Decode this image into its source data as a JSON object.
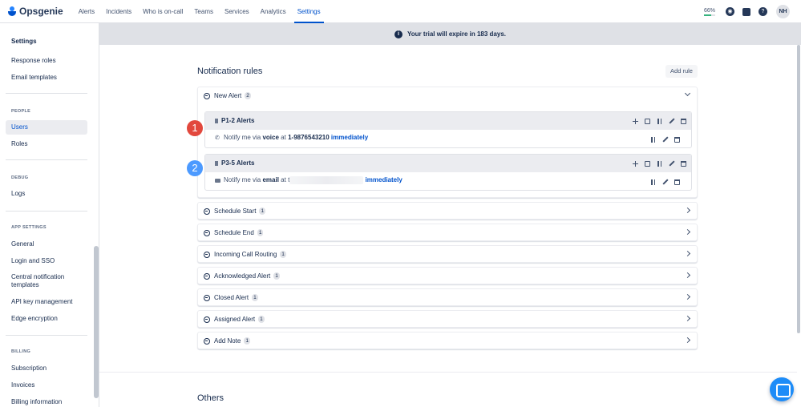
{
  "nav": {
    "brand": "Opsgenie",
    "items": [
      "Alerts",
      "Incidents",
      "Who is on-call",
      "Teams",
      "Services",
      "Analytics",
      "Settings"
    ],
    "active": "Settings",
    "progress_text": "66%",
    "progress_value": 0.66,
    "avatar_initials": "NH"
  },
  "sidebar": {
    "title": "Settings",
    "group_top": [
      "Response roles",
      "Email templates"
    ],
    "people_header": "PEOPLE",
    "people": [
      "Users",
      "Roles"
    ],
    "debug_header": "DEBUG",
    "debug": [
      "Logs"
    ],
    "app_header": "APP SETTINGS",
    "app": [
      "General",
      "Login and SSO",
      "Central notification templates",
      "API key management",
      "Edge encryption"
    ],
    "billing_header": "BILLING",
    "billing": [
      "Subscription",
      "Invoices",
      "Billing information"
    ],
    "active": "Users"
  },
  "banner": {
    "icon": "info-icon",
    "text": "Your trial will expire in 183 days."
  },
  "main": {
    "title": "Notification rules",
    "add_rule": "Add rule",
    "expanded_rule": {
      "label": "New Alert",
      "count": "2",
      "subrules": [
        {
          "step": "1",
          "title": "P1-2 Alerts",
          "prefix": "Notify me via",
          "method": "voice",
          "at": "at",
          "target": "1-9876543210",
          "when": "immediately"
        },
        {
          "step": "2",
          "title": "P3-5 Alerts",
          "prefix": "Notify me via",
          "method": "email",
          "at": "at",
          "target_start": "t",
          "when": "immediately"
        }
      ]
    },
    "rules": [
      {
        "label": "Schedule Start",
        "count": "1"
      },
      {
        "label": "Schedule End",
        "count": "1"
      },
      {
        "label": "Incoming Call Routing",
        "count": "1"
      },
      {
        "label": "Acknowledged Alert",
        "count": "1"
      },
      {
        "label": "Closed Alert",
        "count": "1"
      },
      {
        "label": "Assigned Alert",
        "count": "1"
      },
      {
        "label": "Add Note",
        "count": "1"
      }
    ],
    "others_title": "Others"
  },
  "colors": {
    "accent": "#0052cc",
    "step1": "#e2483d",
    "step2": "#4c9aff",
    "chat": "#1d8cf8"
  }
}
